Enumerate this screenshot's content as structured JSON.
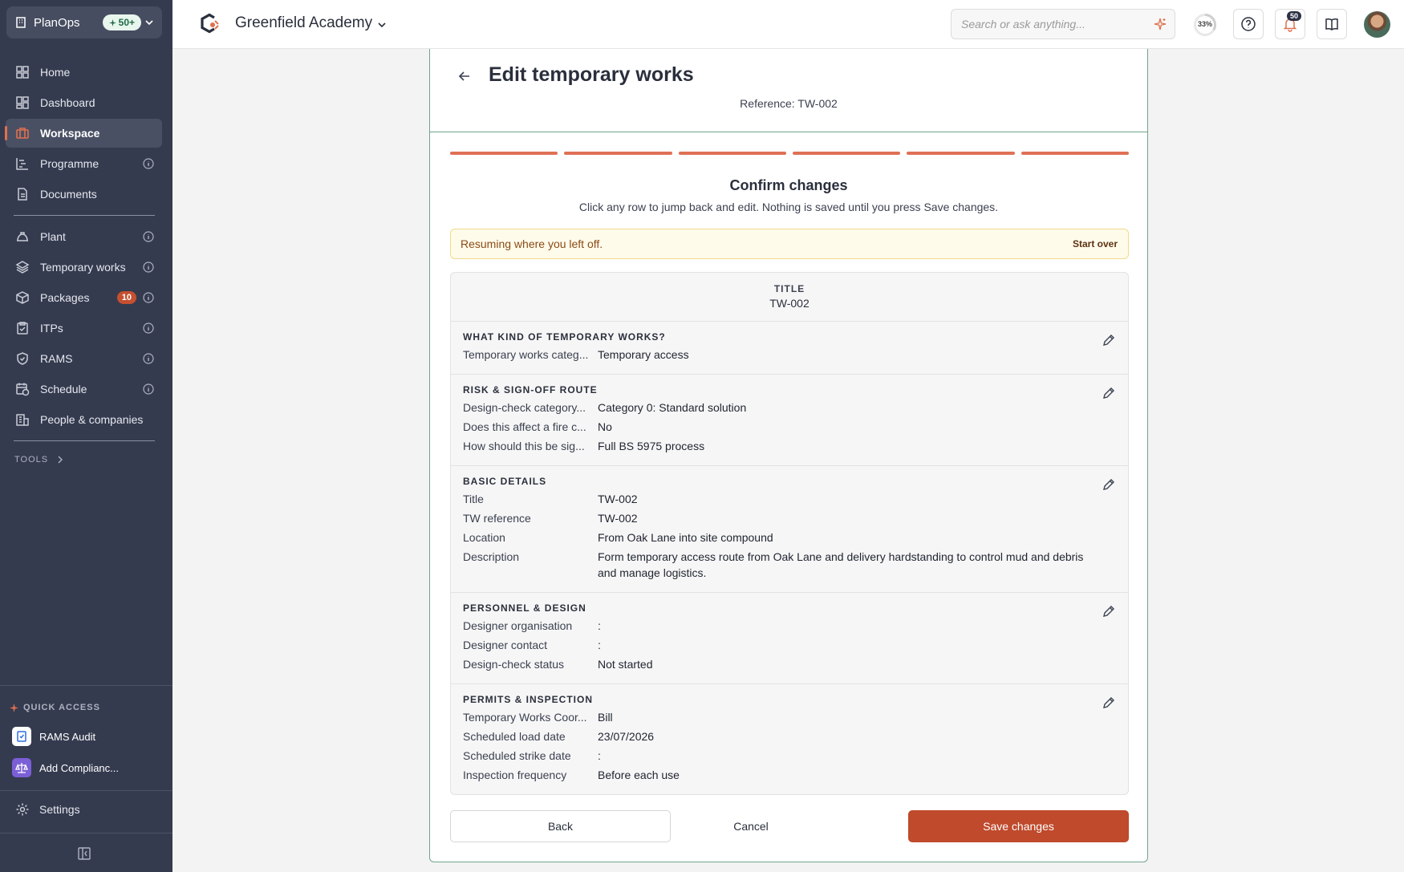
{
  "sidebar": {
    "org": "PlanOps",
    "org_badge": "50+",
    "items": [
      {
        "label": "Home"
      },
      {
        "label": "Dashboard"
      },
      {
        "label": "Workspace"
      },
      {
        "label": "Programme"
      },
      {
        "label": "Documents"
      },
      {
        "label": "Plant"
      },
      {
        "label": "Temporary works"
      },
      {
        "label": "Packages",
        "count": "10"
      },
      {
        "label": "ITPs"
      },
      {
        "label": "RAMS"
      },
      {
        "label": "Schedule"
      },
      {
        "label": "People & companies"
      }
    ],
    "tools_label": "TOOLS",
    "quick_access_label": "QUICK ACCESS",
    "quick_access": [
      {
        "label": "RAMS Audit"
      },
      {
        "label": "Add Complianc..."
      }
    ],
    "settings_label": "Settings",
    "accent": "#e0704e"
  },
  "topbar": {
    "project": "Greenfield Academy",
    "search_placeholder": "Search or ask anything...",
    "progress": "33%",
    "notifications": "50"
  },
  "page": {
    "title": "Edit temporary works",
    "reference": "Reference: TW-002",
    "steps_total": 6,
    "steps_complete": 6,
    "confirm_title": "Confirm changes",
    "confirm_sub": "Click any row to jump back and edit. Nothing is saved until you press Save changes.",
    "resume_text": "Resuming where you left off.",
    "start_over": "Start over",
    "summary_title_label": "TITLE",
    "summary_title_value": "TW-002",
    "sections": [
      {
        "heading": "WHAT KIND OF TEMPORARY WORKS?",
        "rows": [
          {
            "label": "Temporary works categ...",
            "value": "Temporary access"
          }
        ]
      },
      {
        "heading": "RISK & SIGN-OFF ROUTE",
        "rows": [
          {
            "label": "Design-check category...",
            "value": "Category 0: Standard solution"
          },
          {
            "label": "Does this affect a fire c...",
            "value": "No"
          },
          {
            "label": "How should this be sig...",
            "value": "Full BS 5975 process"
          }
        ]
      },
      {
        "heading": "BASIC DETAILS",
        "rows": [
          {
            "label": "Title",
            "value": "TW-002"
          },
          {
            "label": "TW reference",
            "value": "TW-002"
          },
          {
            "label": "Location",
            "value": "From Oak Lane into site compound"
          },
          {
            "label": "Description",
            "value": "Form temporary access route from Oak Lane and delivery hardstanding to control mud and debris and manage logistics."
          }
        ]
      },
      {
        "heading": "PERSONNEL & DESIGN",
        "rows": [
          {
            "label": "Designer organisation",
            "value": ":"
          },
          {
            "label": "Designer contact",
            "value": ":"
          },
          {
            "label": "Design-check status",
            "value": "Not started"
          }
        ]
      },
      {
        "heading": "PERMITS & INSPECTION",
        "rows": [
          {
            "label": "Temporary Works Coor...",
            "value": "Bill"
          },
          {
            "label": "Scheduled load date",
            "value": "23/07/2026"
          },
          {
            "label": "Scheduled strike date",
            "value": ":"
          },
          {
            "label": "Inspection frequency",
            "value": "Before each use"
          }
        ]
      }
    ],
    "buttons": {
      "back": "Back",
      "cancel": "Cancel",
      "save": "Save changes"
    }
  }
}
